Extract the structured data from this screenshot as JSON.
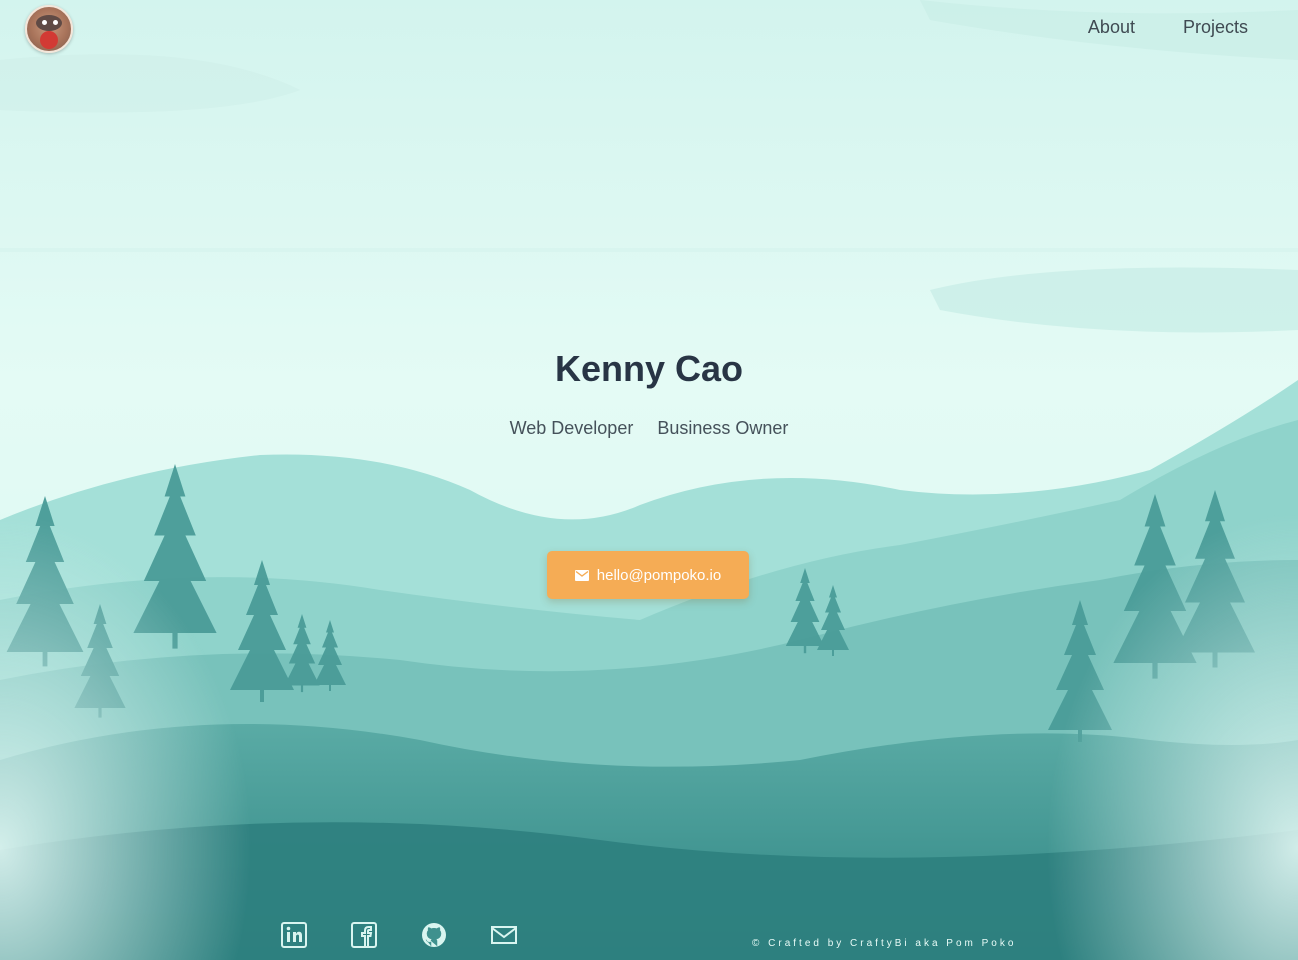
{
  "header": {
    "logo_name": "raccoon-avatar-logo",
    "nav": [
      {
        "label": "About"
      },
      {
        "label": "Projects"
      }
    ]
  },
  "hero": {
    "title": "Kenny Cao",
    "roles": [
      "Web Developer",
      "Business Owner"
    ],
    "cta": {
      "icon": "mail-icon",
      "label": "hello@pompoko.io"
    }
  },
  "footer": {
    "socials": [
      {
        "name": "linkedin-icon"
      },
      {
        "name": "facebook-icon"
      },
      {
        "name": "github-icon"
      },
      {
        "name": "email-icon"
      }
    ],
    "credit": "© Crafted by CraftyBi aka Pom Poko"
  },
  "colors": {
    "sky": "#dff7f1",
    "cta": "#f5ac55",
    "title": "#283545",
    "forest_dark": "#3a8f8c"
  }
}
